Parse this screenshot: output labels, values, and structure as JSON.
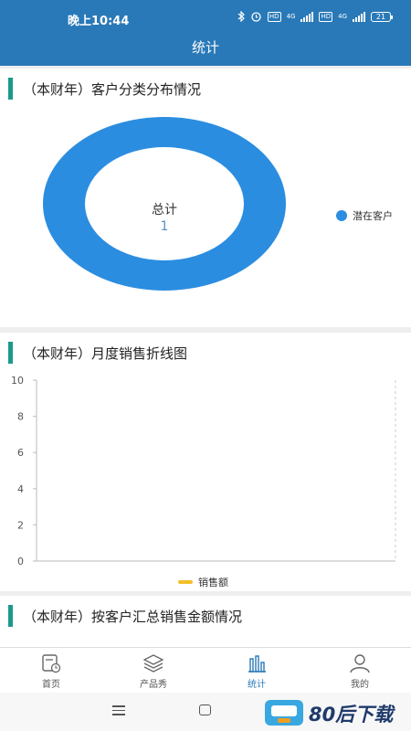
{
  "status_bar": {
    "time": "晚上10:44",
    "network_1": "4G",
    "network_2": "4G",
    "hd": "HD",
    "battery": "21"
  },
  "header": {
    "title": "统计"
  },
  "sections": {
    "customer_distribution": {
      "title": "（本财年）客户分类分布情况",
      "center_label": "总计",
      "center_value": "1"
    },
    "monthly_sales": {
      "title": "（本财年）月度销售折线图"
    },
    "sales_by_customer": {
      "title": "（本财年）按客户汇总销售金额情况"
    }
  },
  "chart_data": [
    {
      "type": "pie",
      "variant": "donut",
      "categories": [
        "潜在客户"
      ],
      "values": [
        1
      ],
      "colors": [
        "#2b8de0"
      ],
      "legend_position": "right"
    },
    {
      "type": "line",
      "x": [],
      "series": [
        {
          "name": "销售额",
          "values": [],
          "color": "#f2c028"
        }
      ],
      "ylim": [
        0,
        10
      ],
      "y_ticks": [
        "0",
        "2",
        "4",
        "6",
        "8",
        "10"
      ],
      "grid": false,
      "legend_position": "bottom"
    }
  ],
  "bottom_nav": {
    "items": [
      {
        "label": "首页",
        "icon": "home-clock-icon"
      },
      {
        "label": "产品秀",
        "icon": "layers-icon"
      },
      {
        "label": "统计",
        "icon": "bar-chart-icon",
        "active": true
      },
      {
        "label": "我的",
        "icon": "user-icon"
      }
    ]
  },
  "watermark": {
    "text": "80后下载"
  },
  "colors": {
    "primary": "#2979b8",
    "accent_bar": "#1b9a8c",
    "donut": "#2b8de0",
    "series_sales": "#f2c028"
  }
}
